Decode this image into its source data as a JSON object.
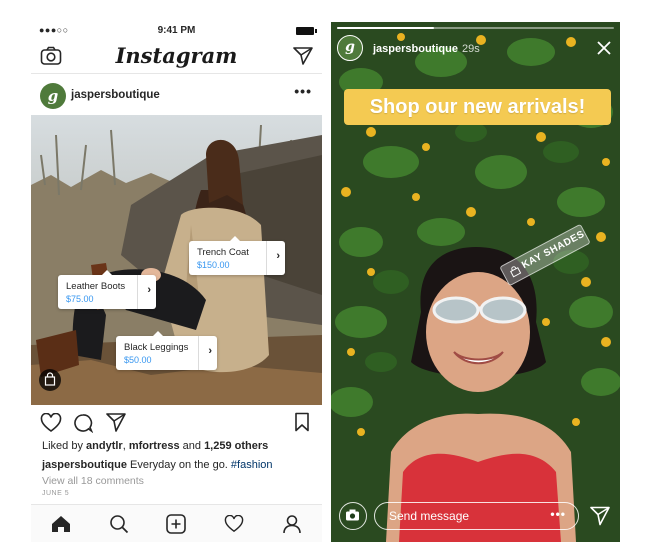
{
  "feed": {
    "status_bar": {
      "signal": "●●●○○",
      "time": "9:41 PM"
    },
    "header": {
      "logo": "Instagram",
      "camera_icon": "camera-icon",
      "direct_icon": "paper-plane-icon"
    },
    "post": {
      "username": "jaspersboutique",
      "avatar_letter": "g",
      "more": "•••",
      "tags": [
        {
          "name": "Trench Coat",
          "price": "$150.00"
        },
        {
          "name": "Leather Boots",
          "price": "$75.00"
        },
        {
          "name": "Black Leggings",
          "price": "$50.00"
        }
      ],
      "shopping_icon": "shopping-bag-icon",
      "likes": {
        "prefix": "Liked by ",
        "user1": "andytlr",
        "sep": ", ",
        "user2": "mfortress",
        "mid": " and ",
        "count": "1,259 others"
      },
      "caption": {
        "user": "jaspersboutique",
        "text": " Everyday on the go. ",
        "hashtag": "#fashion"
      },
      "comments_link": "View all 18 comments",
      "date": "JUNE 5"
    },
    "bottom_nav": [
      "home-icon",
      "search-icon",
      "add-post-icon",
      "heart-icon",
      "profile-icon"
    ]
  },
  "story": {
    "username": "jaspersboutique",
    "time": "29s",
    "avatar_letter": "g",
    "progress": 0.35,
    "banner": "Shop our new arrivals!",
    "sticker": "KAY SHADES",
    "message_placeholder": "Send message",
    "more": "•••"
  },
  "colors": {
    "link_blue": "#3897f0",
    "hashtag": "#003569",
    "banner_yellow": "#f4ca52",
    "brand_green": "#4f7a3b"
  }
}
